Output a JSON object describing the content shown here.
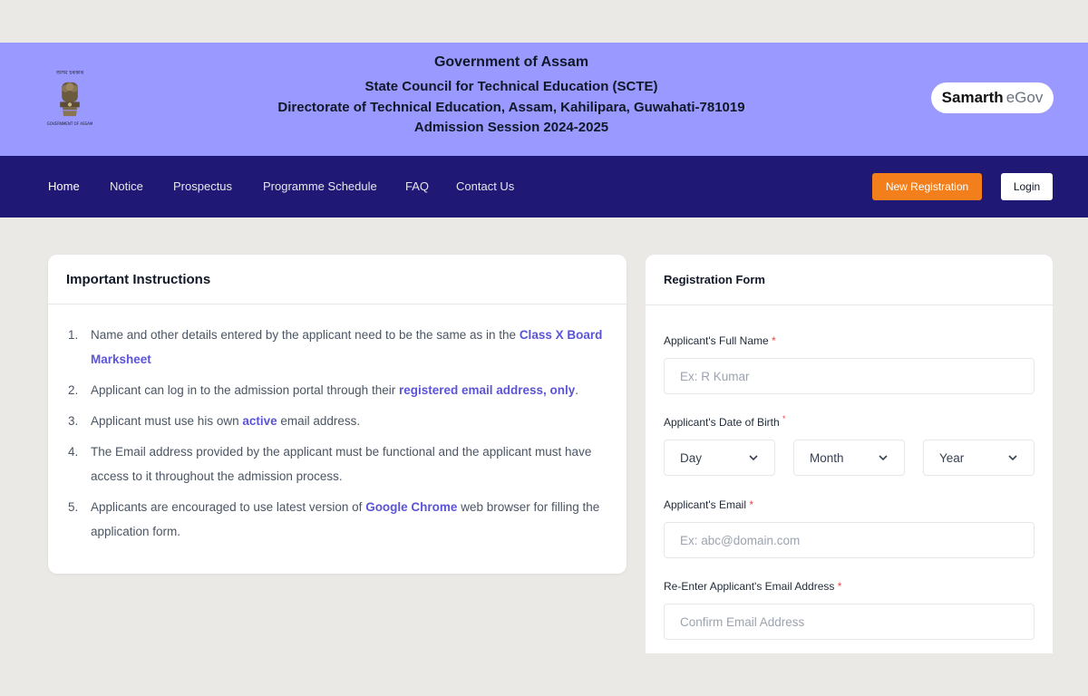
{
  "header": {
    "emblem_top": "অসম চৰকাৰ",
    "emblem_bottom": "GOVERNMENT OF ASSAM",
    "title": "Government of Assam",
    "council": "State Council for Technical Education (SCTE)",
    "directorate": "Directorate of Technical Education, Assam, Kahilipara, Guwahati-781019",
    "session": "Admission Session 2024-2025",
    "brand_primary": "Samarth",
    "brand_secondary": "eGov"
  },
  "nav": {
    "items": [
      {
        "label": "Home"
      },
      {
        "label": "Notice"
      },
      {
        "label": "Prospectus"
      },
      {
        "label": "Programme Schedule"
      },
      {
        "label": "FAQ"
      },
      {
        "label": "Contact Us"
      }
    ],
    "new_registration": "New Registration",
    "login": "Login"
  },
  "instructions": {
    "title": "Important Instructions",
    "items": [
      {
        "num": "1.",
        "pre": "Name and other details entered by the applicant need to be the same as in the ",
        "hl": "Class X Board Marksheet",
        "post": ""
      },
      {
        "num": "2.",
        "pre": "Applicant can log in to the admission portal through their ",
        "hl": "registered email address, only",
        "post": "."
      },
      {
        "num": "3.",
        "pre": "Applicant must use his own ",
        "hl": "active",
        "post": " email address."
      },
      {
        "num": "4.",
        "pre": "The Email address provided by the applicant must be functional and the applicant must have access to it throughout the admission process.",
        "hl": "",
        "post": ""
      },
      {
        "num": "5.",
        "pre": "Applicants are encouraged to use latest version of ",
        "hl": "Google Chrome",
        "post": " web browser for filling the application form."
      }
    ]
  },
  "form": {
    "title": "Registration Form",
    "full_name": {
      "label": "Applicant's Full Name",
      "required": "*",
      "placeholder": "Ex: R Kumar"
    },
    "dob": {
      "label": "Applicant's Date of Birth",
      "required": "*",
      "day": "Day",
      "month": "Month",
      "year": "Year"
    },
    "email": {
      "label": "Applicant's Email",
      "required": "*",
      "placeholder": "Ex: abc@domain.com"
    },
    "confirm_email": {
      "label": "Re-Enter Applicant's Email Address",
      "required": "*",
      "placeholder": "Confirm Email Address"
    }
  },
  "colors": {
    "header_bg": "#9999ff",
    "nav_bg": "#1f1875",
    "accent_orange": "#f27f1c",
    "highlight": "#5b54d6"
  }
}
